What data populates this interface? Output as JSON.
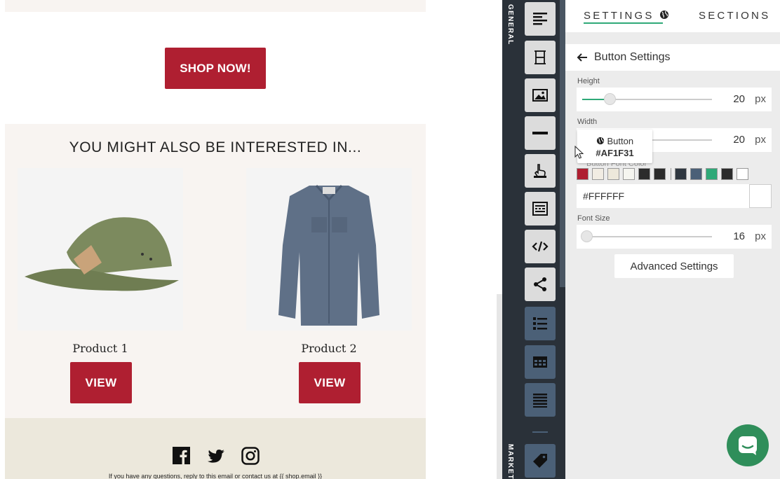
{
  "email": {
    "shop_button": "SHOP NOW!",
    "interest_title": "YOU MIGHT ALSO BE INTERESTED IN...",
    "products": [
      {
        "name": "Product 1",
        "button": "VIEW",
        "icon": "cap-image"
      },
      {
        "name": "Product 2",
        "button": "VIEW",
        "icon": "shirt-image"
      }
    ],
    "footer_text": "If you have any questions, reply to this email or contact us at {{ shop.email }}",
    "social_icons": [
      "facebook-icon",
      "twitter-icon",
      "instagram-icon"
    ]
  },
  "toolbar": {
    "section_general": "GENERAL",
    "section_marketing": "MARKETING",
    "buttons": [
      "text-align-icon",
      "spacer-icon",
      "image-icon",
      "divider-icon",
      "button-pointer-icon",
      "footer-block-icon",
      "code-icon",
      "share-icon",
      "list-icon",
      "table-icon",
      "lines-icon",
      "tag-icon"
    ]
  },
  "panel": {
    "tab_settings": "SETTINGS",
    "tab_sections": "SECTIONS",
    "back_title": "Button Settings",
    "height_label": "Height",
    "height_value": "20",
    "width_label": "Width",
    "width_value": "20",
    "font_color_label": "Button Font Color",
    "hex_value": "#FFFFFF",
    "font_size_label": "Font Size",
    "font_size_value": "16",
    "unit": "px",
    "advanced_button": "Advanced Settings",
    "tooltip_title": "Button",
    "tooltip_hex": "#AF1F31",
    "swatch_colors": [
      "#AF1F31",
      "#f1ece3",
      "#ede8db",
      "#f5f5f0",
      "#2b2b2b",
      "#2b2b2b",
      "#2f3740",
      "#4b6077",
      "#2fa978",
      "#2b2b2b",
      "#ffffff"
    ],
    "height_fraction": 0.18,
    "font_size_fraction": 0.0
  },
  "colors": {
    "accent": "#2fa978",
    "brand_red": "#AF1F31",
    "toolbar": "#2a3139"
  }
}
